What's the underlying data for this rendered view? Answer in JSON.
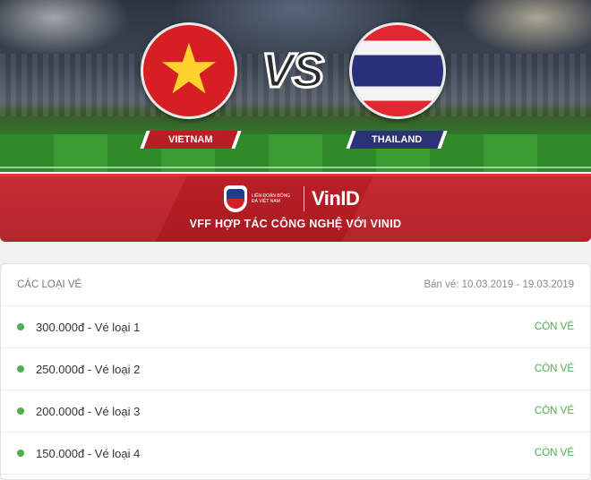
{
  "banner": {
    "team_home": "VIETNAM",
    "team_away": "THAILAND",
    "vs_text": "VS",
    "vff_logo_text": "LIÊN ĐOÀN BÓNG ĐÁ VIỆT NAM",
    "partner_logo": "VinID",
    "tagline": "VFF HỢP TÁC CÔNG NGHỆ VỚI VINID",
    "colors": {
      "red": "#c42129",
      "navy": "#2b3275",
      "star": "#ffd22e"
    }
  },
  "tickets": {
    "header": "CÁC LOẠI VÉ",
    "sale_dates": "Bán vé: 10.03.2019 - 19.03.2019",
    "status_color": "#4caf50",
    "items": [
      {
        "label": "300.000đ - Vé loại 1",
        "status": "CÒN VÉ"
      },
      {
        "label": "250.000đ - Vé loại 2",
        "status": "CÒN VÉ"
      },
      {
        "label": "200.000đ - Vé loại 3",
        "status": "CÒN VÉ"
      },
      {
        "label": "150.000đ - Vé loại 4",
        "status": "CÒN VÉ"
      }
    ]
  }
}
